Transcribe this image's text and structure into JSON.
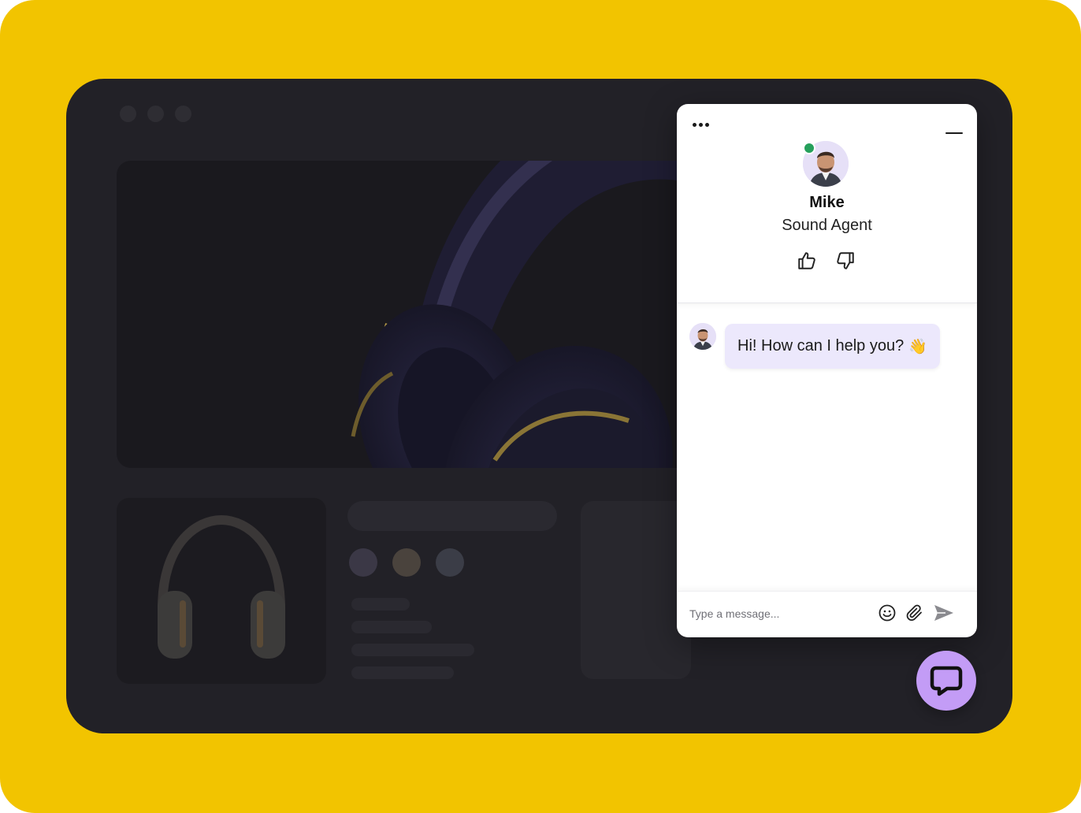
{
  "agent": {
    "name": "Mike",
    "role": "Sound Agent",
    "status": "online"
  },
  "messages": [
    {
      "from": "agent",
      "text": "Hi! How can I help you?",
      "emoji": "👋"
    }
  ],
  "composer": {
    "placeholder": "Type a message..."
  },
  "colors": {
    "background": "#f2c400",
    "window": "#222127",
    "bubble": "#ece8fc",
    "launcher": "#c39cf6",
    "online": "#25a05b"
  },
  "icons": [
    "more-icon",
    "minimize-icon",
    "thumbs-up-icon",
    "thumbs-down-icon",
    "emoji-icon",
    "attach-icon",
    "send-icon",
    "chat-launcher-icon"
  ]
}
